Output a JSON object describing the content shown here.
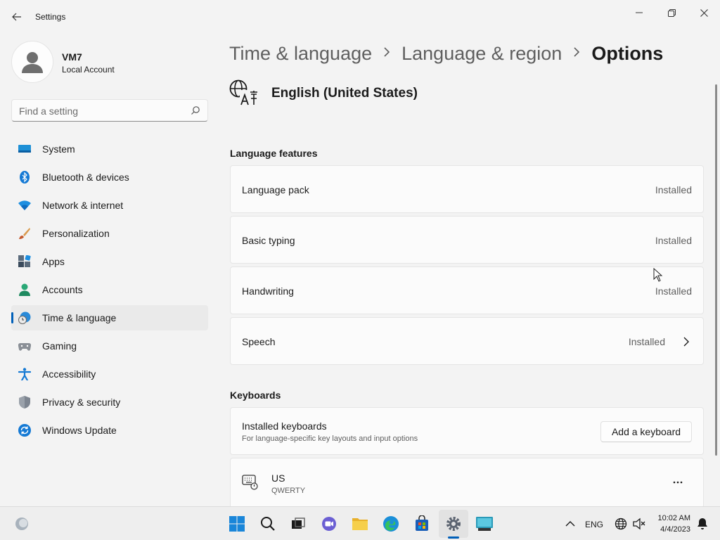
{
  "window": {
    "title": "Settings"
  },
  "user": {
    "name": "VM7",
    "account_type": "Local Account"
  },
  "search": {
    "placeholder": "Find a setting"
  },
  "sidebar": {
    "items": [
      {
        "label": "System",
        "icon": "system-icon"
      },
      {
        "label": "Bluetooth & devices",
        "icon": "bluetooth-icon"
      },
      {
        "label": "Network & internet",
        "icon": "wifi-icon"
      },
      {
        "label": "Personalization",
        "icon": "brush-icon"
      },
      {
        "label": "Apps",
        "icon": "apps-icon"
      },
      {
        "label": "Accounts",
        "icon": "person-icon"
      },
      {
        "label": "Time & language",
        "icon": "globe-clock-icon",
        "active": true
      },
      {
        "label": "Gaming",
        "icon": "gamepad-icon"
      },
      {
        "label": "Accessibility",
        "icon": "accessibility-icon"
      },
      {
        "label": "Privacy & security",
        "icon": "shield-icon"
      },
      {
        "label": "Windows Update",
        "icon": "update-icon"
      }
    ]
  },
  "breadcrumb": {
    "items": [
      "Time & language",
      "Language & region"
    ],
    "current": "Options"
  },
  "language": {
    "name": "English (United States)"
  },
  "features": {
    "title": "Language features",
    "items": [
      {
        "label": "Language pack",
        "status": "Installed"
      },
      {
        "label": "Basic typing",
        "status": "Installed"
      },
      {
        "label": "Handwriting",
        "status": "Installed"
      },
      {
        "label": "Speech",
        "status": "Installed"
      }
    ]
  },
  "keyboards": {
    "title": "Keyboards",
    "installed_title": "Installed keyboards",
    "installed_subtitle": "For language-specific key layouts and input options",
    "add_button": "Add a keyboard",
    "list": [
      {
        "name": "US",
        "layout": "QWERTY"
      }
    ]
  },
  "taskbar": {
    "input_indicator": "ENG",
    "time": "10:02 AM",
    "date": "4/4/2023"
  },
  "colors": {
    "accent": "#005fb8",
    "background": "#f3f3f3",
    "card": "#fbfbfb"
  }
}
